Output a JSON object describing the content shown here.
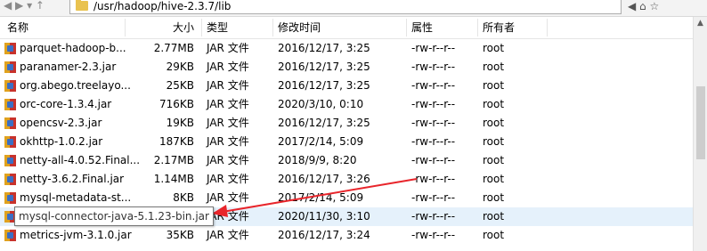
{
  "nav": {
    "arrows": "◀ ▶ ▾ ↑"
  },
  "path": "/usr/hadoop/hive-2.3.7/lib",
  "window_buttons": "◀ ⌂ ☆",
  "columns": {
    "name": "名称",
    "size": "大小",
    "type": "类型",
    "date": "修改时间",
    "attr": "属性",
    "owner": "所有者"
  },
  "rows": [
    {
      "name": "parquet-hadoop-b...",
      "size": "2.77MB",
      "type": "JAR 文件",
      "date": "2016/12/17, 3:25",
      "attr": "-rw-r--r--",
      "owner": "root"
    },
    {
      "name": "paranamer-2.3.jar",
      "size": "29KB",
      "type": "JAR 文件",
      "date": "2016/12/17, 3:25",
      "attr": "-rw-r--r--",
      "owner": "root"
    },
    {
      "name": "org.abego.treelayo...",
      "size": "25KB",
      "type": "JAR 文件",
      "date": "2016/12/17, 3:25",
      "attr": "-rw-r--r--",
      "owner": "root"
    },
    {
      "name": "orc-core-1.3.4.jar",
      "size": "716KB",
      "type": "JAR 文件",
      "date": "2020/3/10, 0:10",
      "attr": "-rw-r--r--",
      "owner": "root"
    },
    {
      "name": "opencsv-2.3.jar",
      "size": "19KB",
      "type": "JAR 文件",
      "date": "2016/12/17, 3:25",
      "attr": "-rw-r--r--",
      "owner": "root"
    },
    {
      "name": "okhttp-1.0.2.jar",
      "size": "187KB",
      "type": "JAR 文件",
      "date": "2017/2/14, 5:09",
      "attr": "-rw-r--r--",
      "owner": "root"
    },
    {
      "name": "netty-all-4.0.52.Final...",
      "size": "2.17MB",
      "type": "JAR 文件",
      "date": "2018/9/9, 8:20",
      "attr": "-rw-r--r--",
      "owner": "root"
    },
    {
      "name": "netty-3.6.2.Final.jar",
      "size": "1.14MB",
      "type": "JAR 文件",
      "date": "2016/12/17, 3:26",
      "attr": "-rw-r--r--",
      "owner": "root"
    },
    {
      "name": "mysql-metadata-st...",
      "size": "8KB",
      "type": "JAR 文件",
      "date": "2017/2/14, 5:09",
      "attr": "-rw-r--r--",
      "owner": "root"
    },
    {
      "name": "",
      "size": "",
      "type": "JAR 文件",
      "date": "2020/11/30, 3:10",
      "attr": "-rw-r--r--",
      "owner": "root"
    },
    {
      "name": "metrics-jvm-3.1.0.jar",
      "size": "35KB",
      "type": "JAR 文件",
      "date": "2016/12/17, 3:24",
      "attr": "-rw-r--r--",
      "owner": "root"
    }
  ],
  "tooltip": "mysql-connector-java-5.1.23-bin.jar",
  "selected_row": 9,
  "colors": {
    "selection": "#e5f1fb",
    "arrow": "#e8252b",
    "folder": "#e9c24f"
  }
}
